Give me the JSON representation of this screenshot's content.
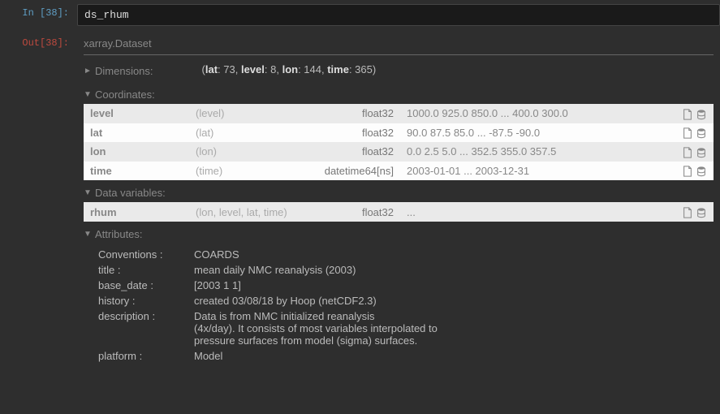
{
  "input": {
    "prompt": "In [38]:",
    "code": "ds_rhum"
  },
  "output": {
    "prompt": "Out[38]:"
  },
  "xr": {
    "header": "xarray.Dataset",
    "sections": {
      "dimensions": {
        "label": "Dimensions:",
        "caret": "►",
        "text_parts": {
          "open": "(",
          "k1": "lat",
          "v1": ": 73, ",
          "k2": "level",
          "v2": ": 8, ",
          "k3": "lon",
          "v3": ": 144, ",
          "k4": "time",
          "v4": ": 365",
          "close": ")"
        }
      },
      "coordinates": {
        "label": "Coordinates:",
        "caret": "▼",
        "rows": [
          {
            "name": "level",
            "dims": "(level)",
            "dtype": "float32",
            "preview": "1000.0 925.0 850.0 ... 400.0 300.0"
          },
          {
            "name": "lat",
            "dims": "(lat)",
            "dtype": "float32",
            "preview": "90.0 87.5 85.0 ... -87.5 -90.0"
          },
          {
            "name": "lon",
            "dims": "(lon)",
            "dtype": "float32",
            "preview": "0.0 2.5 5.0 ... 352.5 355.0 357.5"
          },
          {
            "name": "time",
            "dims": "(time)",
            "dtype": "datetime64[ns]",
            "preview": "2003-01-01 ... 2003-12-31"
          }
        ]
      },
      "data_vars": {
        "label": "Data variables:",
        "caret": "▼",
        "rows": [
          {
            "name": "rhum",
            "dims": "(lon, level, lat, time)",
            "dtype": "float32",
            "preview": "..."
          }
        ]
      },
      "attributes": {
        "label": "Attributes:",
        "caret": "▼",
        "items": [
          {
            "key": "Conventions :",
            "val": "COARDS"
          },
          {
            "key": "title :",
            "val": "mean daily NMC reanalysis (2003)"
          },
          {
            "key": "base_date :",
            "val": "[2003    1    1]"
          },
          {
            "key": "history :",
            "val": "created 03/08/18 by Hoop (netCDF2.3)"
          },
          {
            "key": "description :",
            "val": "Data is from NMC initialized reanalysis\n(4x/day).  It consists of most variables interpolated to\npressure surfaces from model (sigma) surfaces."
          },
          {
            "key": "platform :",
            "val": "Model"
          }
        ]
      }
    }
  }
}
